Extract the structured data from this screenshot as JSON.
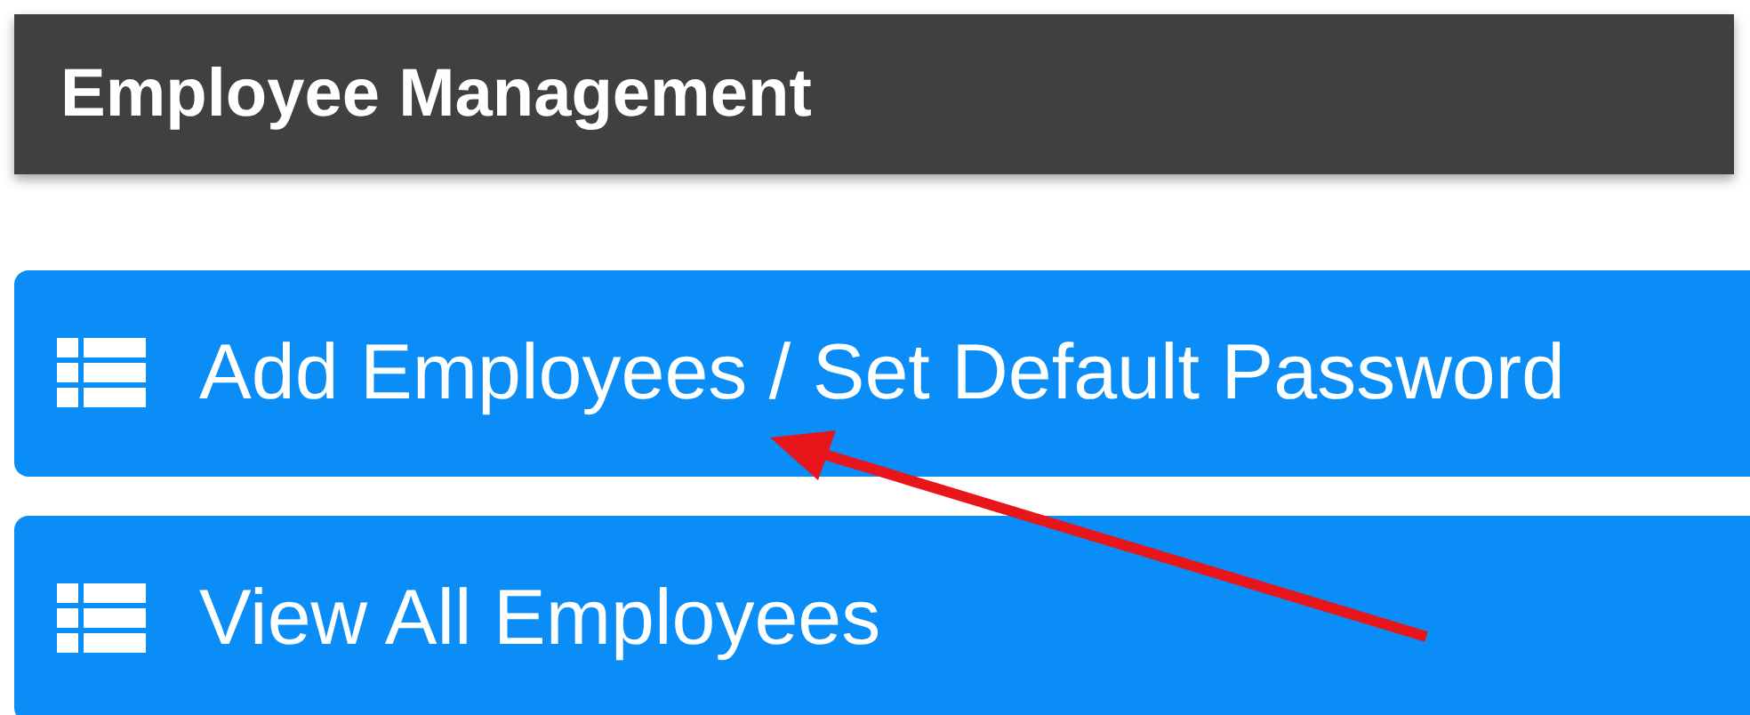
{
  "header": {
    "title": "Employee Management"
  },
  "menu": [
    {
      "label": "Add Employees / Set Default Password"
    },
    {
      "label": "View All Employees"
    }
  ]
}
